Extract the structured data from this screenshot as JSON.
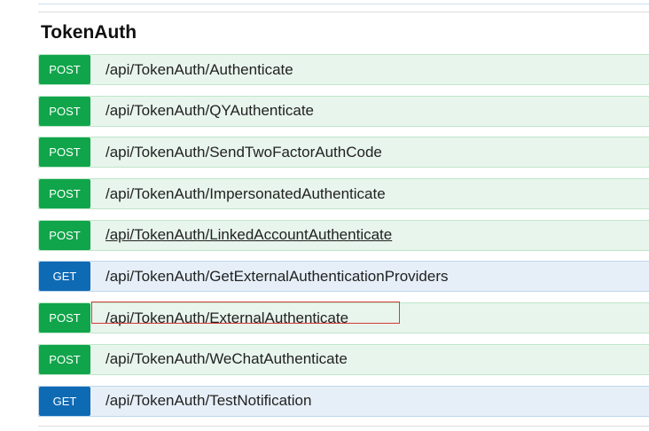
{
  "section": {
    "title": "TokenAuth"
  },
  "operations": [
    {
      "method": "POST",
      "path": "/api/TokenAuth/Authenticate"
    },
    {
      "method": "POST",
      "path": "/api/TokenAuth/QYAuthenticate"
    },
    {
      "method": "POST",
      "path": "/api/TokenAuth/SendTwoFactorAuthCode"
    },
    {
      "method": "POST",
      "path": "/api/TokenAuth/ImpersonatedAuthenticate"
    },
    {
      "method": "POST",
      "path": "/api/TokenAuth/LinkedAccountAuthenticate"
    },
    {
      "method": "GET",
      "path": "/api/TokenAuth/GetExternalAuthenticationProviders"
    },
    {
      "method": "POST",
      "path": "/api/TokenAuth/ExternalAuthenticate"
    },
    {
      "method": "POST",
      "path": "/api/TokenAuth/WeChatAuthenticate"
    },
    {
      "method": "GET",
      "path": "/api/TokenAuth/TestNotification"
    }
  ],
  "colors": {
    "post_badge": "#10a54a",
    "post_row": "#e8f5ec",
    "get_badge": "#0f6ab4",
    "get_row": "#e6eff8",
    "highlight_border": "#d33a3a"
  }
}
